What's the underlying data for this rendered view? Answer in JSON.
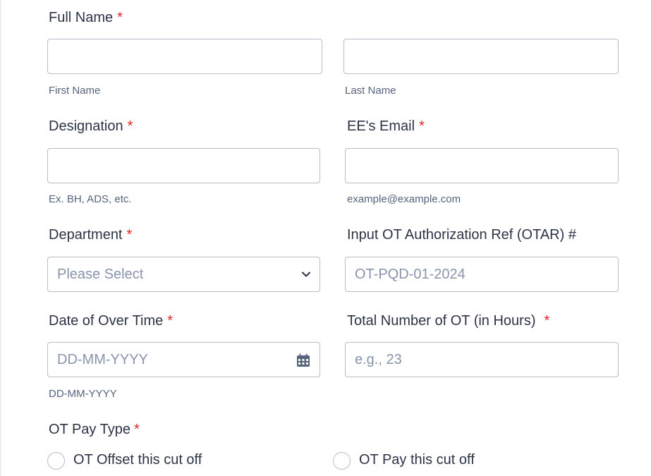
{
  "full_name": {
    "label": "Full Name",
    "required_mark": "*",
    "first_sublabel": "First Name",
    "last_sublabel": "Last Name",
    "first_value": "",
    "last_value": ""
  },
  "designation": {
    "label": "Designation",
    "required_mark": "*",
    "value": "",
    "sublabel": "Ex. BH, ADS, etc."
  },
  "email": {
    "label": "EE's Email",
    "required_mark": "*",
    "value": "",
    "sublabel": "example@example.com"
  },
  "department": {
    "label": "Department",
    "required_mark": "*",
    "selected": "Please Select",
    "icon": "chevron-down-icon"
  },
  "otar": {
    "label": "Input OT Authorization Ref (OTAR) #",
    "placeholder": "OT-PQD-01-2024"
  },
  "ot_date": {
    "label": "Date of Over Time",
    "required_mark": "*",
    "placeholder": "DD-MM-YYYY",
    "sublabel": "DD-MM-YYYY",
    "icon": "calendar-icon"
  },
  "ot_hours": {
    "label": "Total Number of OT (in Hours)",
    "required_mark": "*",
    "placeholder": "e.g., 23"
  },
  "pay_type": {
    "label": "OT Pay Type",
    "required_mark": "*",
    "options": [
      {
        "label": "OT Offset this cut off",
        "checked": false
      },
      {
        "label": "OT Pay this cut off",
        "checked": false
      }
    ]
  },
  "colors": {
    "required": "#e02424",
    "border": "#b8bdc9",
    "text": "#2c3345",
    "sublabel": "#57647e",
    "placeholder": "#8894ab"
  }
}
